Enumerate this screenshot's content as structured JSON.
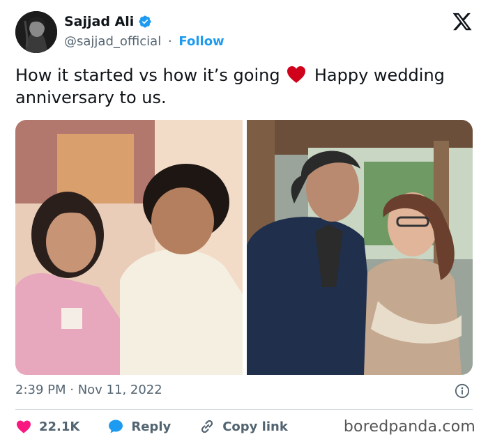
{
  "author": {
    "name": "Sajjad Ali",
    "handle": "@sajjad_official",
    "separator": "·",
    "follow_label": "Follow"
  },
  "tweet": {
    "text_before": "How it started vs how it’s going",
    "emoji": "red-heart",
    "text_after": "Happy wedding anniversary to us."
  },
  "media": {
    "left_image": "childhood-photo",
    "right_image": "couple-photo"
  },
  "meta": {
    "timestamp": "2:39 PM · Nov 11, 2022"
  },
  "actions": {
    "likes": "22.1K",
    "reply_label": "Reply",
    "copy_link_label": "Copy link"
  },
  "watermark": "boredpanda.com",
  "colors": {
    "accent": "#1d9bf0",
    "like": "#f91880",
    "text": "#0f1419",
    "muted": "#536471"
  }
}
